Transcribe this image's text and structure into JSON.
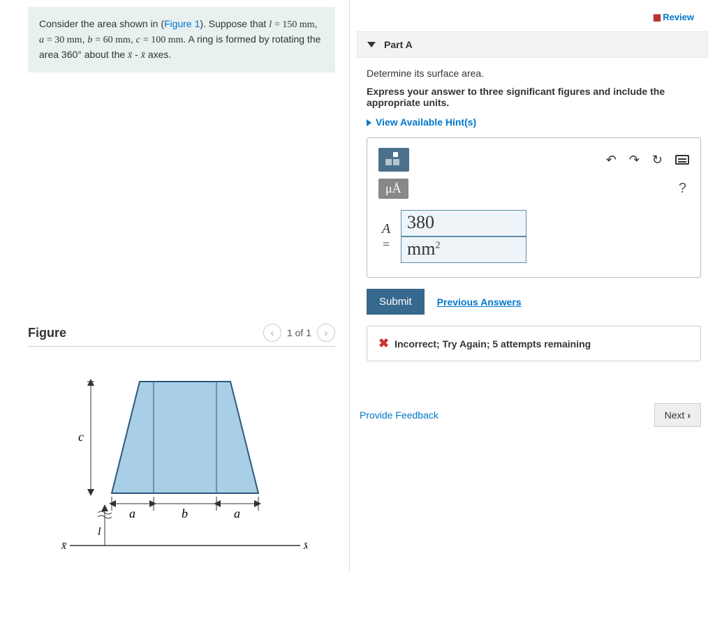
{
  "problem": {
    "intro_before": "Consider the area shown in (",
    "fig_link": "Figure 1",
    "intro_after": "). Suppose that ",
    "params_html": "l = 150 mm, a = 30 mm, b = 60 mm, c = 100 mm.",
    "rotation": " A ring is formed by rotating the area 360° about the x̄ - x̄ axes.",
    "values": {
      "l": 150,
      "a": 30,
      "b": 60,
      "c": 100,
      "l_unit": "mm"
    }
  },
  "figure": {
    "title": "Figure",
    "pager": "1 of 1",
    "labels": {
      "a": "a",
      "b": "b",
      "c": "c",
      "l": "l",
      "x": "x̄"
    }
  },
  "review_label": "Review",
  "part": {
    "title": "Part A",
    "prompt": "Determine its surface area.",
    "instruction": "Express your answer to three significant figures and include the appropriate units.",
    "hints_label": "View Available Hint(s)",
    "unit_btn": "μÅ",
    "help": "?",
    "answer_symbol": "A",
    "equals": "=",
    "answer_value": "380",
    "answer_units_base": "mm",
    "answer_units_exp": "2",
    "submit": "Submit",
    "previous": "Previous Answers",
    "feedback": "Incorrect; Try Again; 5 attempts remaining"
  },
  "footer": {
    "provide_feedback": "Provide Feedback",
    "next": "Next"
  }
}
